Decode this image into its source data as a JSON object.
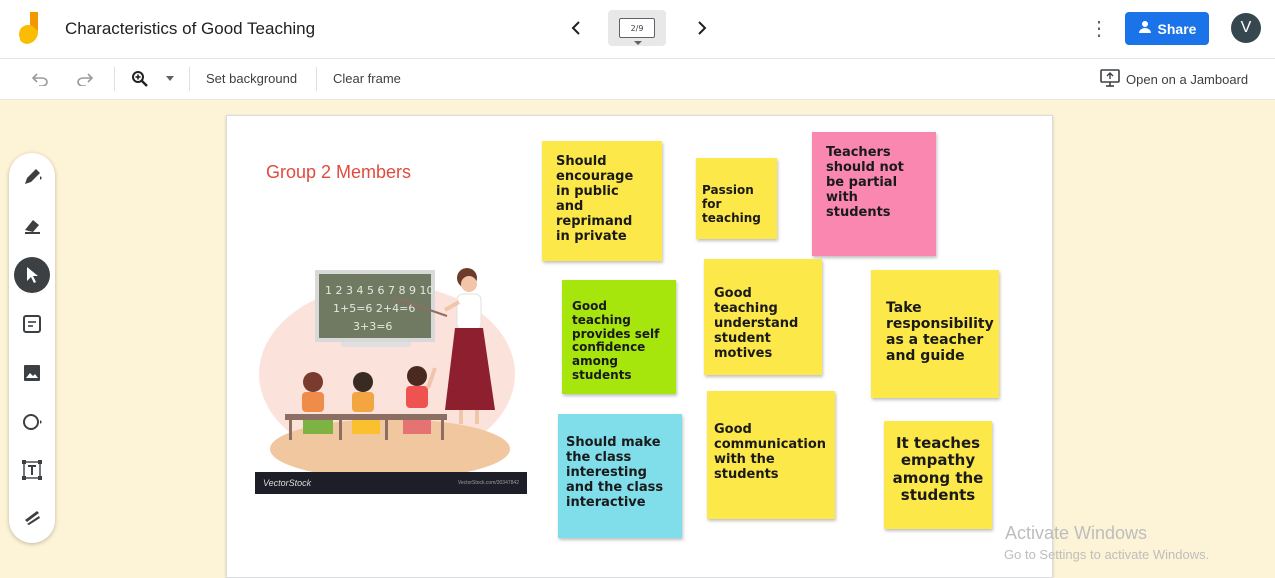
{
  "header": {
    "title": "Characteristics of Good Teaching",
    "frame_indicator": "2/9",
    "share_label": "Share",
    "avatar_initial": "V"
  },
  "toolbar": {
    "set_background": "Set background",
    "clear_frame": "Clear frame",
    "open_on_jamboard": "Open on a Jamboard"
  },
  "frame": {
    "group_title": "Group 2 Members",
    "image_banner": {
      "brand": "VectorStock",
      "id": "VectorStock.com/30347842"
    },
    "notes": [
      {
        "text": "Should encourage in public and reprimand in private",
        "color": "#fde84a"
      },
      {
        "text": "Passion for teaching",
        "color": "#fde84a"
      },
      {
        "text": "Teachers should not be partial with students",
        "color": "#f987b0"
      },
      {
        "text": "Good teaching provides self confidence among students",
        "color": "#a6e60c"
      },
      {
        "text": "Good teaching understand student motives",
        "color": "#fde84a"
      },
      {
        "text": "Take responsibility as a teacher and guide",
        "color": "#fde84a"
      },
      {
        "text": "Should make the class interesting and the class interactive",
        "color": "#7fdeea"
      },
      {
        "text": "Good communication with the students",
        "color": "#fde84a"
      },
      {
        "text": "It teaches empathy among the students",
        "color": "#fde84a"
      }
    ]
  },
  "sidebar": {
    "tools": [
      "pen-icon",
      "eraser-icon",
      "select-icon",
      "sticky-note-icon",
      "image-icon",
      "circle-icon",
      "text-box-icon",
      "laser-icon"
    ]
  },
  "watermark": {
    "line1": "Activate Windows",
    "line2": "Go to Settings to activate Windows."
  }
}
